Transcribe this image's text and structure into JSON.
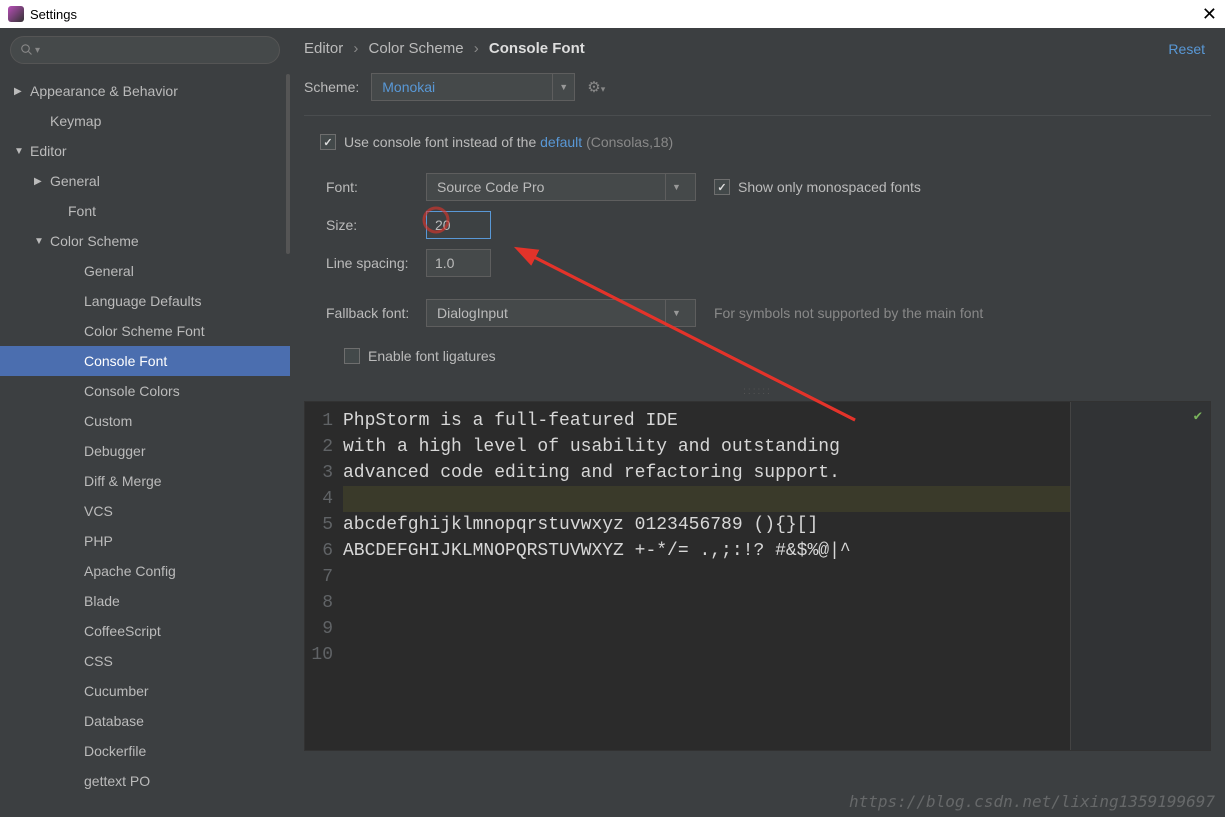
{
  "window": {
    "title": "Settings"
  },
  "sidebar": {
    "items": [
      {
        "label": "Appearance & Behavior",
        "arrow": "▶",
        "lvl": 0
      },
      {
        "label": "Keymap",
        "arrow": "",
        "lvl": 1
      },
      {
        "label": "Editor",
        "arrow": "▼",
        "lvl": 0
      },
      {
        "label": "General",
        "arrow": "▶",
        "lvl": 1
      },
      {
        "label": "Font",
        "arrow": "",
        "lvl": 2
      },
      {
        "label": "Color Scheme",
        "arrow": "▼",
        "lvl": 1
      },
      {
        "label": "General",
        "arrow": "",
        "lvl": 3
      },
      {
        "label": "Language Defaults",
        "arrow": "",
        "lvl": 3
      },
      {
        "label": "Color Scheme Font",
        "arrow": "",
        "lvl": 3
      },
      {
        "label": "Console Font",
        "arrow": "",
        "lvl": 3,
        "selected": true
      },
      {
        "label": "Console Colors",
        "arrow": "",
        "lvl": 3
      },
      {
        "label": "Custom",
        "arrow": "",
        "lvl": 3
      },
      {
        "label": "Debugger",
        "arrow": "",
        "lvl": 3
      },
      {
        "label": "Diff & Merge",
        "arrow": "",
        "lvl": 3
      },
      {
        "label": "VCS",
        "arrow": "",
        "lvl": 3
      },
      {
        "label": "PHP",
        "arrow": "",
        "lvl": 3
      },
      {
        "label": "Apache Config",
        "arrow": "",
        "lvl": 3
      },
      {
        "label": "Blade",
        "arrow": "",
        "lvl": 3
      },
      {
        "label": "CoffeeScript",
        "arrow": "",
        "lvl": 3
      },
      {
        "label": "CSS",
        "arrow": "",
        "lvl": 3
      },
      {
        "label": "Cucumber",
        "arrow": "",
        "lvl": 3
      },
      {
        "label": "Database",
        "arrow": "",
        "lvl": 3
      },
      {
        "label": "Dockerfile",
        "arrow": "",
        "lvl": 3
      },
      {
        "label": "gettext PO",
        "arrow": "",
        "lvl": 3
      }
    ]
  },
  "breadcrumb": {
    "a": "Editor",
    "b": "Color Scheme",
    "c": "Console Font"
  },
  "actions": {
    "reset": "Reset"
  },
  "scheme": {
    "label": "Scheme:",
    "value": "Monokai"
  },
  "use_console": {
    "prefix": "Use console font instead of the",
    "link": "default",
    "hint": "(Consolas,18)",
    "checked": true
  },
  "font": {
    "label": "Font:",
    "value": "Source Code Pro"
  },
  "mono": {
    "label": "Show only monospaced fonts",
    "checked": true
  },
  "size": {
    "label": "Size:",
    "value": "20"
  },
  "spacing": {
    "label": "Line spacing:",
    "value": "1.0"
  },
  "fallback": {
    "label": "Fallback font:",
    "value": "DialogInput",
    "hint": "For symbols not supported by the main font"
  },
  "ligatures": {
    "label": "Enable font ligatures",
    "checked": false
  },
  "preview": {
    "lines": [
      "PhpStorm is a full-featured IDE",
      "with a high level of usability and outstanding",
      "advanced code editing and refactoring support.",
      "",
      "abcdefghijklmnopqrstuvwxyz 0123456789 (){}[]",
      "ABCDEFGHIJKLMNOPQRSTUVWXYZ +-*/= .,;:!? #&$%@|^",
      "",
      "",
      "",
      ""
    ]
  },
  "watermark": "https://blog.csdn.net/lixing1359199697"
}
